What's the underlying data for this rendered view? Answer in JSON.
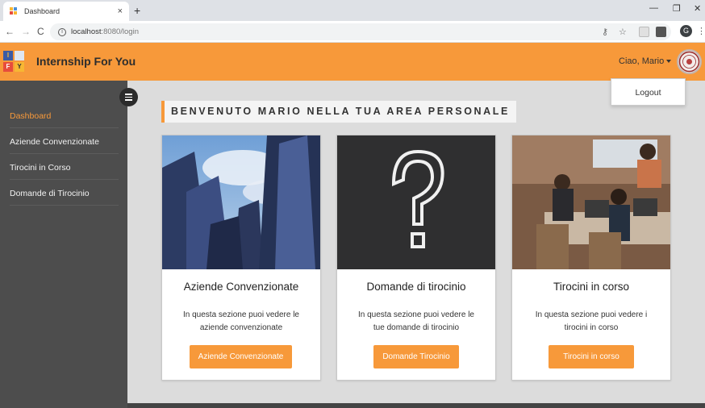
{
  "browser": {
    "tab_title": "Dashboard",
    "tab_close": "×",
    "new_tab": "+",
    "url_host": "localhost",
    "url_path": ":8080/login",
    "profile_initial": "G"
  },
  "header": {
    "brand": "Internship For You",
    "logo_letters": [
      "I",
      "F",
      "Y"
    ],
    "user_greeting": "Ciao, Mario"
  },
  "user_dropdown": {
    "logout": "Logout"
  },
  "sidebar": {
    "items": [
      {
        "label": "Dashboard",
        "active": true
      },
      {
        "label": "Aziende Convenzionate",
        "active": false
      },
      {
        "label": "Tirocini in Corso",
        "active": false
      },
      {
        "label": "Domande di Tirocinio",
        "active": false
      }
    ]
  },
  "main": {
    "welcome": "BENVENUTO MARIO NELLA TUA AREA PERSONALE",
    "cards": [
      {
        "title": "Aziende Convenzionate",
        "text": "In questa sezione puoi vedere le aziende convenzionate",
        "button": "Aziende Convenzionate"
      },
      {
        "title": "Domande di tirocinio",
        "text": "In questa sezione puoi vedere le tue domande di tirocinio",
        "button": "Domande Tirocinio"
      },
      {
        "title": "Tirocini in corso",
        "text": "In questa sezione puoi vedere i tirocini in corso",
        "button": "Tirocini in corso"
      }
    ]
  },
  "colors": {
    "accent": "#f7993a",
    "sidebar_bg": "#4d4d4d",
    "main_bg": "#dcdcdc"
  },
  "icons": [
    "back-arrow-icon",
    "forward-arrow-icon",
    "reload-icon",
    "info-icon",
    "key-icon",
    "star-icon",
    "menu-icon",
    "kebab-icon"
  ]
}
